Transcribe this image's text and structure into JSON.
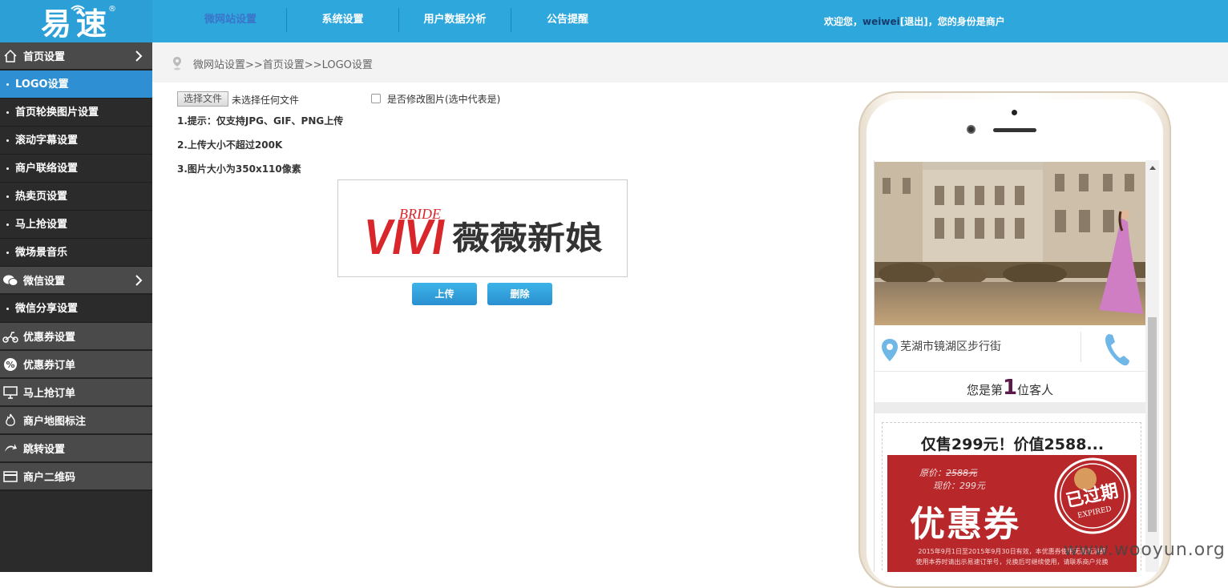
{
  "header": {
    "logo_text": "易速",
    "logo_reg": "®",
    "nav": [
      "微网站设置",
      "系统设置",
      "用户数据分析",
      "公告提醒"
    ],
    "welcome_prefix": "欢迎您，",
    "username": "weiwei",
    "logout": "[退出]",
    "welcome_suffix": "，您的身份是商户"
  },
  "sidebar": {
    "home_group": "首页设置",
    "home_items": [
      "LOGO设置",
      "首页轮换图片设置",
      "滚动字幕设置",
      "商户联络设置",
      "热卖页设置",
      "马上抢设置",
      "微场景音乐"
    ],
    "wechat_group": "微信设置",
    "wechat_items": [
      "微信分享设置"
    ],
    "other_groups": [
      "优惠券设置",
      "优惠券订单",
      "马上抢订单",
      "商户地图标注",
      "跳转设置",
      "商户二维码"
    ]
  },
  "breadcrumb": "微网站设置>>首页设置>>LOGO设置",
  "upload": {
    "choose_file": "选择文件",
    "no_file": "未选择任何文件",
    "modify_label": "是否修改图片(选中代表是)",
    "tips": [
      "1.提示：仅支持JPG、GIF、PNG上传",
      "2.上传大小不超过200K",
      "3.图片大小为350x110像素"
    ],
    "upload_btn": "上传",
    "delete_btn": "删除"
  },
  "logo_preview": {
    "brand_en": "VIVI",
    "brand_small": "BRIDE",
    "brand_cn": "薇薇新娘"
  },
  "phone": {
    "address": "芜湖市镜湖区步行街",
    "visit_prefix": "您是第",
    "visit_num": "1",
    "visit_suffix": "位客人",
    "offer_title": "仅售299元！价值2588...",
    "orig_label": "原价：",
    "orig_price": "2588元",
    "now_label": "现价：",
    "now_price": "299元",
    "coupon_big": "优惠券",
    "fine_1": "2015年9月1日至2015年9月30日有效，本优惠券使用无最低消费",
    "fine_2": "使用本券时请出示易速订单号，兑换后可继续使用，请联系商户兑换",
    "stamp_text": "已过期",
    "stamp_sub": "EXPIRED"
  },
  "watermark": "www.wooyun.org",
  "colors": {
    "topbar": "#2ea7dd",
    "sidebar": "#2b2b2b",
    "active": "#2e8fd3",
    "coupon": "#b8272a",
    "brand_red": "#d8262a"
  }
}
